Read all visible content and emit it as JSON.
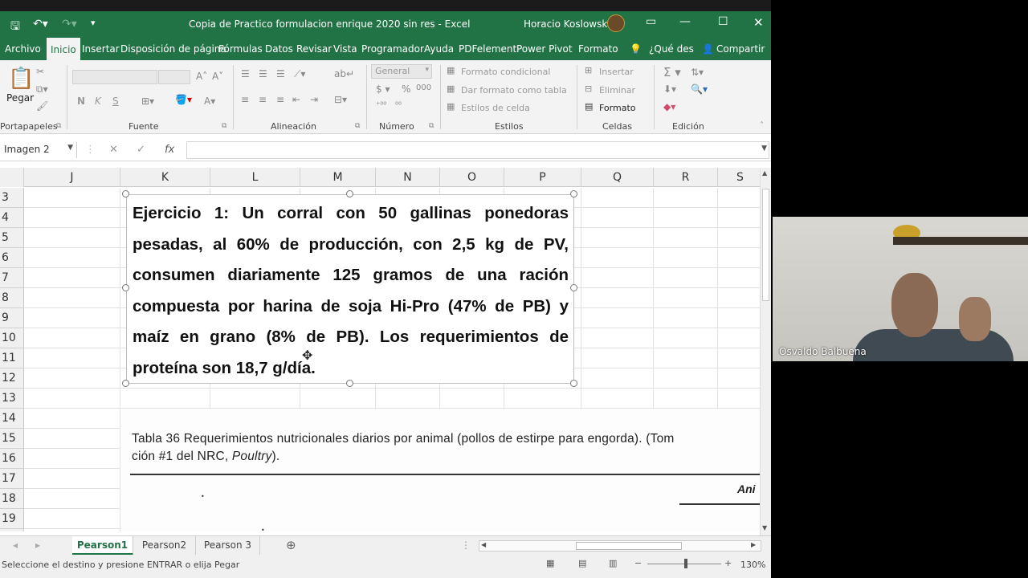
{
  "window": {
    "title": "Copia de Practico formulacion enrique 2020 sin res  -  Excel",
    "user": "Horacio Koslowski"
  },
  "ribbon_tabs": [
    "Archivo",
    "Inicio",
    "Insertar",
    "Disposición de página",
    "Fórmulas",
    "Datos",
    "Revisar",
    "Vista",
    "Programador",
    "Ayuda",
    "PDFelement",
    "Power Pivot",
    "Formato",
    "¿Qué des",
    "Compartir"
  ],
  "ribbon": {
    "paste_label": "Pegar",
    "number_format": "General",
    "conditional_format": "Formato condicional",
    "format_as_table": "Dar formato como tabla",
    "cell_styles": "Estilos de celda",
    "insert": "Insertar",
    "delete": "Eliminar",
    "format": "Formato",
    "bold": "N",
    "italic": "K",
    "underline": "S",
    "group_labels": [
      "Portapapeles",
      "Fuente",
      "Alineación",
      "Número",
      "Estilos",
      "Celdas",
      "Edición"
    ]
  },
  "formula_bar": {
    "name_box": "Imagen 2",
    "fx": "fx",
    "value": ""
  },
  "columns": [
    "J",
    "K",
    "L",
    "M",
    "N",
    "O",
    "P",
    "Q",
    "R",
    "S"
  ],
  "rows": [
    "3",
    "4",
    "5",
    "6",
    "7",
    "8",
    "9",
    "10",
    "11",
    "12",
    "13",
    "14",
    "15",
    "16",
    "17",
    "18",
    "19"
  ],
  "text_image": {
    "text": "Ejercicio 1: Un corral con 50 gallinas ponedoras pesadas, al 60% de producción, con 2,5 kg de PV, consumen diariamente 125 gramos de una ración compuesta por harina de soja Hi-Pro (47% de PB) y maíz en grano (8% de PB). Los requerimientos de proteína son 18,7 g/día."
  },
  "scan_image": {
    "caption_line1": "Tabla 36  Requerimientos nutricionales diarios por animal (pollos de estirpe para engorda). (Tom",
    "caption_line2_pre": "ción #1 del NRC, ",
    "caption_line2_italic": "Poultry",
    "caption_line2_post": ").",
    "header_fragment": "Ani"
  },
  "sheets": [
    "Pearson1",
    "Pearson2",
    "Pearson 3"
  ],
  "active_sheet": "Pearson1",
  "status": {
    "message": "Seleccione el destino y presione ENTRAR o elija Pegar",
    "zoom": "130%"
  },
  "video": {
    "participant": "Osvaldo Balbuena"
  },
  "colors": {
    "excel_green": "#217346"
  }
}
